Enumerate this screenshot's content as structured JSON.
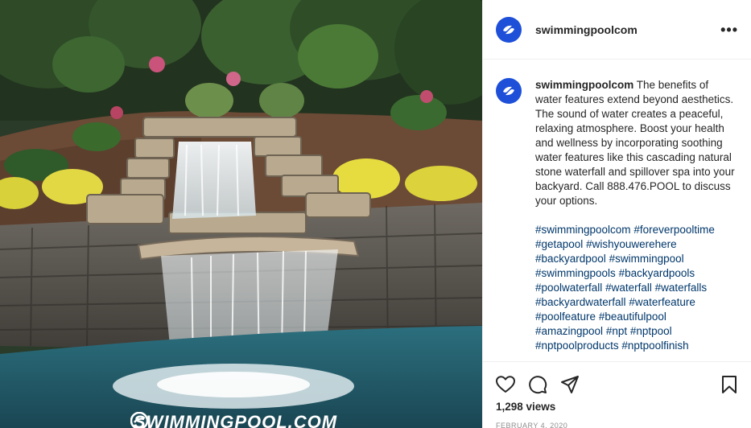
{
  "media": {
    "watermark_text": "SWIMMINGPOOL.COM",
    "description_icon": "waterfall-pool-photo"
  },
  "post": {
    "username": "swimmingpoolcom",
    "more_label": "•••",
    "caption_user": "swimmingpoolcom",
    "caption_text": "The benefits of water features extend beyond aesthetics. The sound of water creates a peaceful, relaxing atmosphere. Boost your health and wellness by incorporating soothing water features like this cascading natural stone waterfall and spillover spa into your backyard. Call 888.476.POOL to discuss your options.",
    "hashtags": [
      "#swimmingpoolcom",
      "#foreverpooltime",
      "#getapool",
      "#wishyouwerehere",
      "#backyardpool",
      "#swimmingpool",
      "#swimmingpools",
      "#backyardpools",
      "#poolwaterfall",
      "#waterfall",
      "#waterfalls",
      "#backyardwaterfall",
      "#waterfeature",
      "#poolfeature",
      "#beautifulpool",
      "#amazingpool",
      "#npt",
      "#nptpool",
      "#nptpoolproducts",
      "#nptpoolfinish"
    ],
    "views": "1,298 views",
    "date": "FEBRUARY 4, 2020"
  },
  "icons": {
    "like": "heart-icon",
    "comment": "comment-icon",
    "share": "send-icon",
    "save": "bookmark-icon"
  },
  "colors": {
    "brand": "#1d4fd8",
    "hashtag": "#00376b",
    "muted": "#8e8e8e"
  }
}
